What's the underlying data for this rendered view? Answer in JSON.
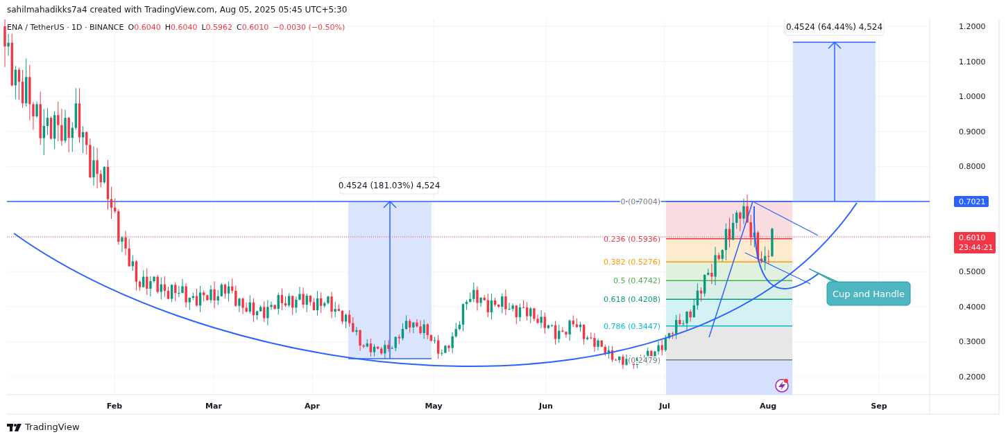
{
  "header": {
    "attribution": "sahilmahadikks7a4 created with TradingView.com, Aug 05, 2025 05:45 UTC+5:30"
  },
  "symbol": {
    "pair": "ENA / TetherUS · 1D · BINANCE",
    "ohlc": [
      {
        "label": "O",
        "value": "0.6040"
      },
      {
        "label": "H",
        "value": "0.6040"
      },
      {
        "label": "L",
        "value": "0.5962"
      },
      {
        "label": "C",
        "value": "0.6010"
      }
    ],
    "change": "−0.0030 (−0.50%)"
  },
  "price_axis": {
    "ticks": [
      "1.2000",
      "1.1000",
      "1.0000",
      "0.9000",
      "0.8000",
      "0.5000",
      "0.4000",
      "0.3000",
      "0.2000"
    ],
    "badges": [
      {
        "kind": "level",
        "text": "0.7021"
      },
      {
        "kind": "last",
        "text": "0.6010",
        "countdown": "23:44:21"
      }
    ]
  },
  "time_axis": {
    "labels": [
      "Feb",
      "Mar",
      "Apr",
      "May",
      "Jun",
      "Jul",
      "Aug",
      "Sep"
    ]
  },
  "fib_levels": [
    {
      "ratio": "0",
      "price": "(0.7004)",
      "color": "#787b86"
    },
    {
      "ratio": "0.236",
      "price": "(0.5936)",
      "color": "#f23645"
    },
    {
      "ratio": "0.382",
      "price": "(0.5276)",
      "color": "#ff9800"
    },
    {
      "ratio": "0.5",
      "price": "(0.4742)",
      "color": "#4caf50"
    },
    {
      "ratio": "0.618",
      "price": "(0.4208)",
      "color": "#089981"
    },
    {
      "ratio": "0.786",
      "price": "(0.3447)",
      "color": "#00bcd4"
    },
    {
      "price": "(0.2479)",
      "color": "#787b86"
    }
  ],
  "measures": [
    {
      "label": "0.4524 (181.03%) 4,524"
    },
    {
      "label": "0.4524 (64.44%) 4,524"
    }
  ],
  "callout": {
    "text": "Cup and Handle"
  },
  "footer": {
    "brand": "TradingView"
  }
}
